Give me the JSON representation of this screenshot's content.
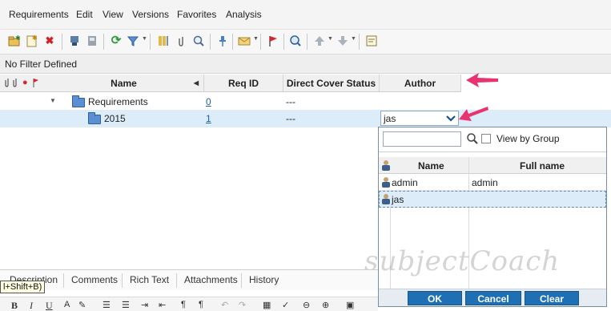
{
  "menubar": {
    "items": [
      "Requirements",
      "Edit",
      "View",
      "Versions",
      "Favorites",
      "Analysis"
    ]
  },
  "toolbar": {
    "icons": [
      "new-folder-icon",
      "new-requirement-icon",
      "delete-icon",
      "convert-to-tests-icon",
      "generate-test-icon",
      "refresh-icon",
      "filter-icon",
      "view-columns-icon",
      "attachment-icon",
      "zoom-in-icon",
      "pin-icon",
      "send-mail-icon",
      "flag-icon",
      "find-icon",
      "move-up-icon",
      "move-down-icon",
      "comments-icon"
    ]
  },
  "filter_bar": {
    "text": "No Filter Defined"
  },
  "grid": {
    "columns": [
      "Name",
      "Req ID",
      "Direct Cover Status",
      "Author"
    ],
    "rows": [
      {
        "name": "Requirements",
        "req_id": "0",
        "cover_status": "---",
        "author": ""
      },
      {
        "name": "2015",
        "req_id": "1",
        "cover_status": "---",
        "author": "jas"
      }
    ]
  },
  "author_combo": {
    "value": "jas"
  },
  "author_popup": {
    "search_value": "",
    "view_by_group_label": "View by Group",
    "view_by_group_checked": false,
    "columns": [
      "Name",
      "Full name"
    ],
    "users": [
      {
        "name": "admin",
        "full_name": "admin",
        "selected": false
      },
      {
        "name": "jas",
        "full_name": "",
        "selected": true
      }
    ],
    "buttons": {
      "ok": "OK",
      "cancel": "Cancel",
      "clear": "Clear"
    }
  },
  "details_tabs": [
    "Description",
    "Comments",
    "Rich Text",
    "Attachments",
    "History"
  ],
  "tooltip": {
    "text": "l+Shift+B)"
  },
  "format_bar": {
    "bold": "B",
    "italic": "I",
    "underline": "U"
  },
  "watermark": {
    "text": "subjectCoach"
  },
  "colors": {
    "selection_row": "#dcecf8",
    "popup_button": "#1f6fb5",
    "link": "#1a5fb4",
    "pointer_arrow": "#e8336f"
  }
}
